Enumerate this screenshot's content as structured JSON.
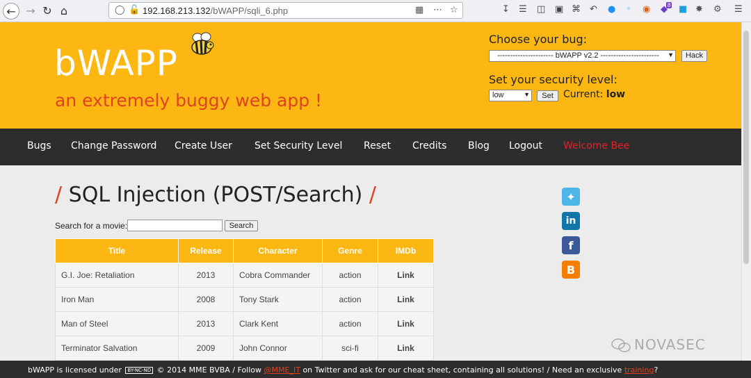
{
  "browser": {
    "url_host": "192.168.213.132",
    "url_path": "/bWAPP/sqli_6.php",
    "toolbar_badge": "8"
  },
  "header": {
    "logo": "bWAPP",
    "tagline": "an extremely buggy web app !",
    "choose_bug_label": "Choose your bug:",
    "bug_selected": "---------------------- bWAPP v2.2 -----------------------",
    "hack_button": "Hack",
    "security_label": "Set your security level:",
    "security_selected": "low",
    "set_button": "Set",
    "current_label": "Current:",
    "current_value": "low"
  },
  "menu": {
    "items": [
      "Bugs",
      "Change Password",
      "Create User",
      "Set Security Level",
      "Reset",
      "Credits",
      "Blog",
      "Logout"
    ],
    "welcome": "Welcome Bee"
  },
  "main": {
    "title": "SQL Injection (POST/Search)",
    "search_label": "Search for a movie:",
    "search_value": "",
    "search_button": "Search",
    "table": {
      "headers": [
        "Title",
        "Release",
        "Character",
        "Genre",
        "IMDb"
      ],
      "rows": [
        [
          "G.I. Joe: Retaliation",
          "2013",
          "Cobra Commander",
          "action",
          "Link"
        ],
        [
          "Iron Man",
          "2008",
          "Tony Stark",
          "action",
          "Link"
        ],
        [
          "Man of Steel",
          "2013",
          "Clark Kent",
          "action",
          "Link"
        ],
        [
          "Terminator Salvation",
          "2009",
          "John Connor",
          "sci-fi",
          "Link"
        ]
      ]
    }
  },
  "footer": {
    "part1": "bWAPP is licensed under",
    "cc_badge": "BY-NC-ND",
    "part2": "© 2014 MME BVBA / Follow",
    "twitter_handle": "@MME_IT",
    "part3": "on Twitter and ask for our cheat sheet, containing all solutions! / Need an exclusive",
    "training_link": "training",
    "part4": "?"
  },
  "watermark": "NOVASEC",
  "colors": {
    "header_bg": "#fdb713",
    "menu_bg": "#2d2d2d",
    "accent_red": "#e0421f",
    "welcome_red": "#e8202a"
  }
}
